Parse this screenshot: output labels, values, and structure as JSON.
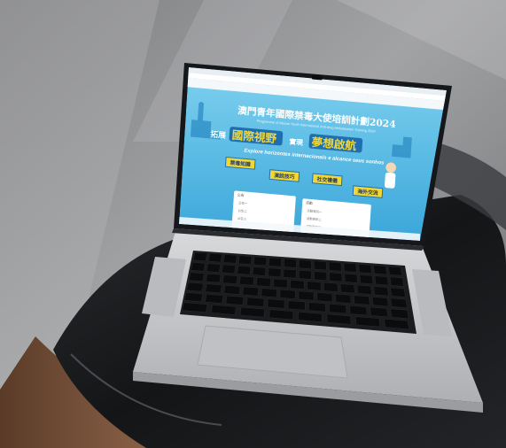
{
  "website": {
    "title_cn": "澳門青年國際禁毒大使培訓計劃2024",
    "subtitle_en": "Programme of Macao Youth International Anti-drug Ambassador Training 2024",
    "slogan_left": "拓展",
    "slogan_highlight_1": "國際視野",
    "slogan_mid": "實現",
    "slogan_highlight_2": "夢想啟航",
    "slogan_es": "Explore horizontes internacionais e alcance seus sonhos",
    "tags": [
      "禁毒知識",
      "演說技巧",
      "社交禮儀",
      "海外交流"
    ],
    "left_card_title": "公告",
    "left_card_items": [
      "公告一",
      "公告二",
      "公告三"
    ],
    "right_card_title": "活動",
    "right_card_items": [
      "活動資訊一",
      "活動資訊二",
      "活動資訊三"
    ]
  },
  "colors": {
    "sky": "#55bfe6",
    "sky_dark": "#2d8cc8",
    "accent_yellow": "#f2d634",
    "bezel": "#15171a",
    "body_silver": "#c9cbcd",
    "floor": "#8e8f90",
    "chair_black": "#1c1d1f",
    "wood": "#6b4a35"
  }
}
